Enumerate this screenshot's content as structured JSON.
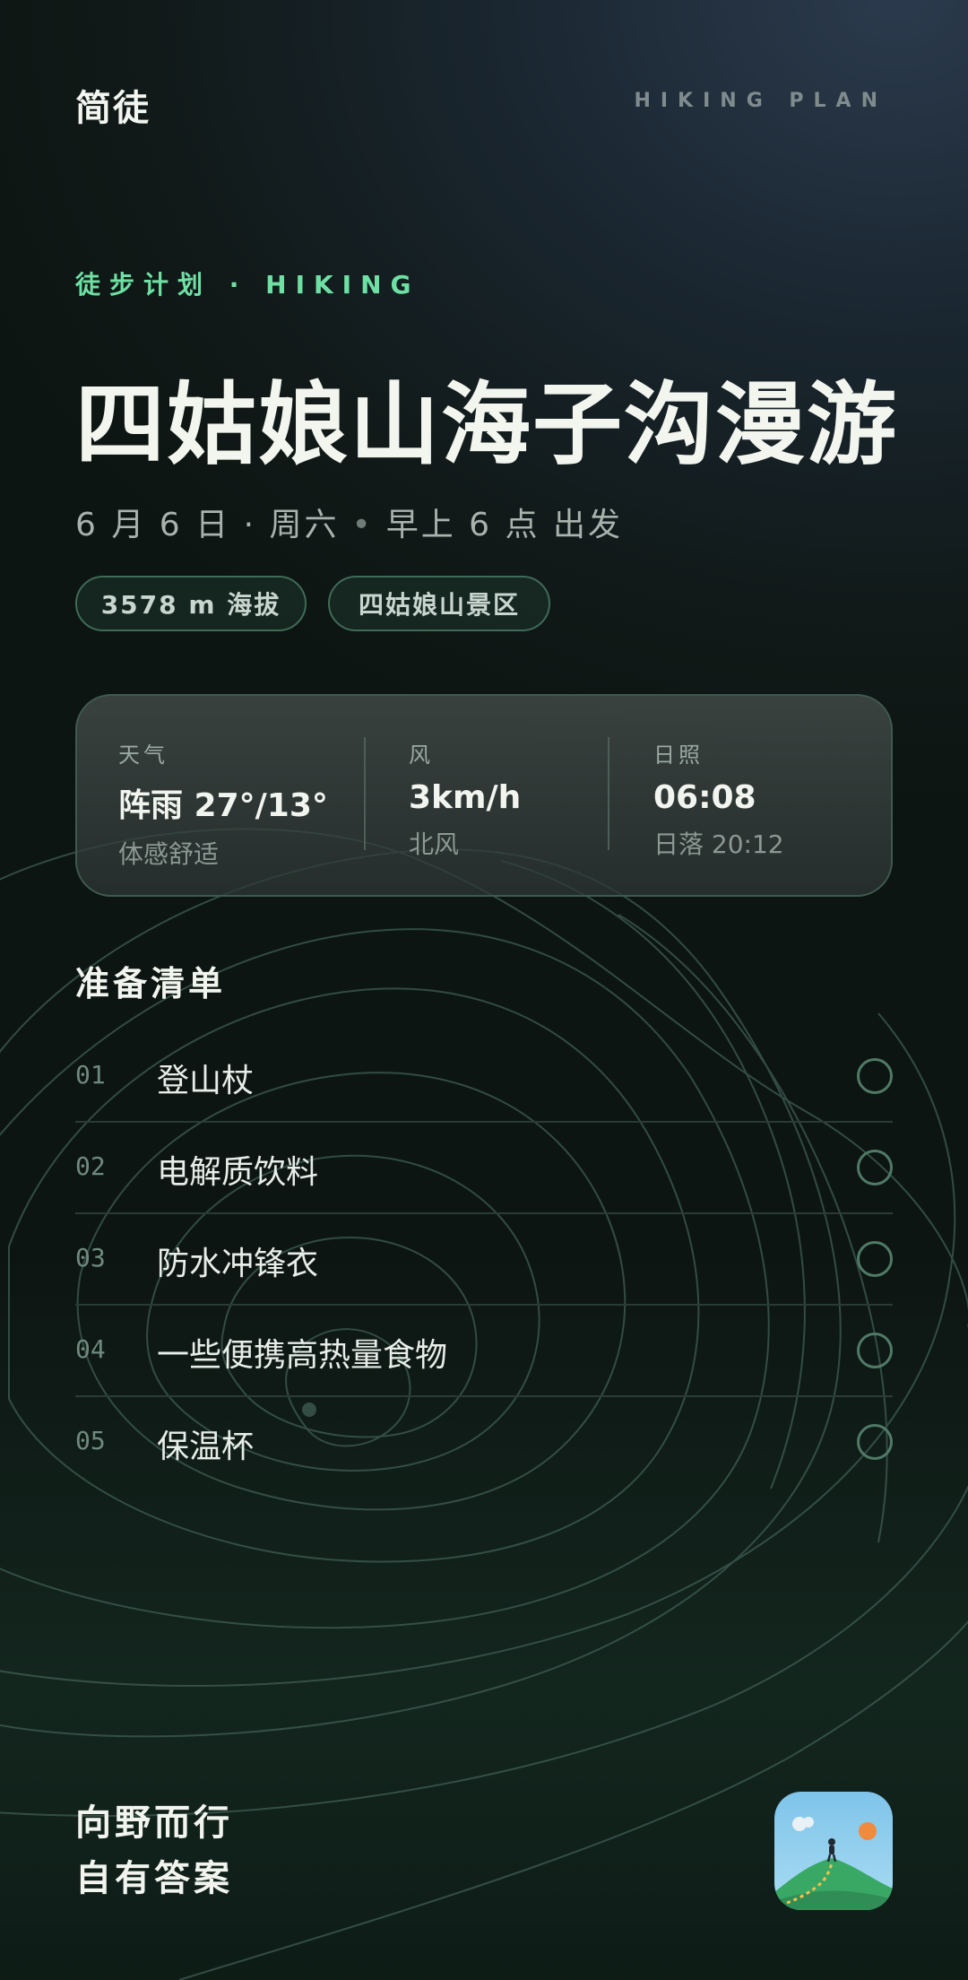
{
  "header": {
    "brand": "简徒",
    "tag": "HIKING PLAN"
  },
  "hero": {
    "eyebrow": "徒步计划 · HIKING",
    "title": "四姑娘山海子沟漫游",
    "date": "6 月 6 日 · 周六",
    "separator": "•",
    "departure": "早上 6 点 出发"
  },
  "pills": [
    {
      "label": "3578 m 海拔"
    },
    {
      "label": "四姑娘山景区"
    }
  ],
  "weather": {
    "condition": {
      "label": "天气",
      "value": "阵雨  27°/13°",
      "sub": "体感舒适"
    },
    "wind": {
      "label": "风",
      "value": "3km/h",
      "sub": "北风"
    },
    "sunlight": {
      "label": "日照",
      "value": "06:08",
      "sub": "日落 20:12"
    }
  },
  "checklist": {
    "title": "准备清单",
    "items": [
      {
        "num": "01",
        "label": "登山杖",
        "checked": false
      },
      {
        "num": "02",
        "label": "电解质饮料",
        "checked": false
      },
      {
        "num": "03",
        "label": "防水冲锋衣",
        "checked": false
      },
      {
        "num": "04",
        "label": "一些便携高热量食物",
        "checked": false
      },
      {
        "num": "05",
        "label": "保温杯",
        "checked": false
      }
    ]
  },
  "footer": {
    "slogan_line1": "向野而行",
    "slogan_line2": "自有答案",
    "app_icon": "hiker-mountain-icon"
  },
  "colors": {
    "accent": "#6fe0a4",
    "background": "#111a19",
    "pill_border": "#3f6b58",
    "check_border": "#4f7a67"
  }
}
